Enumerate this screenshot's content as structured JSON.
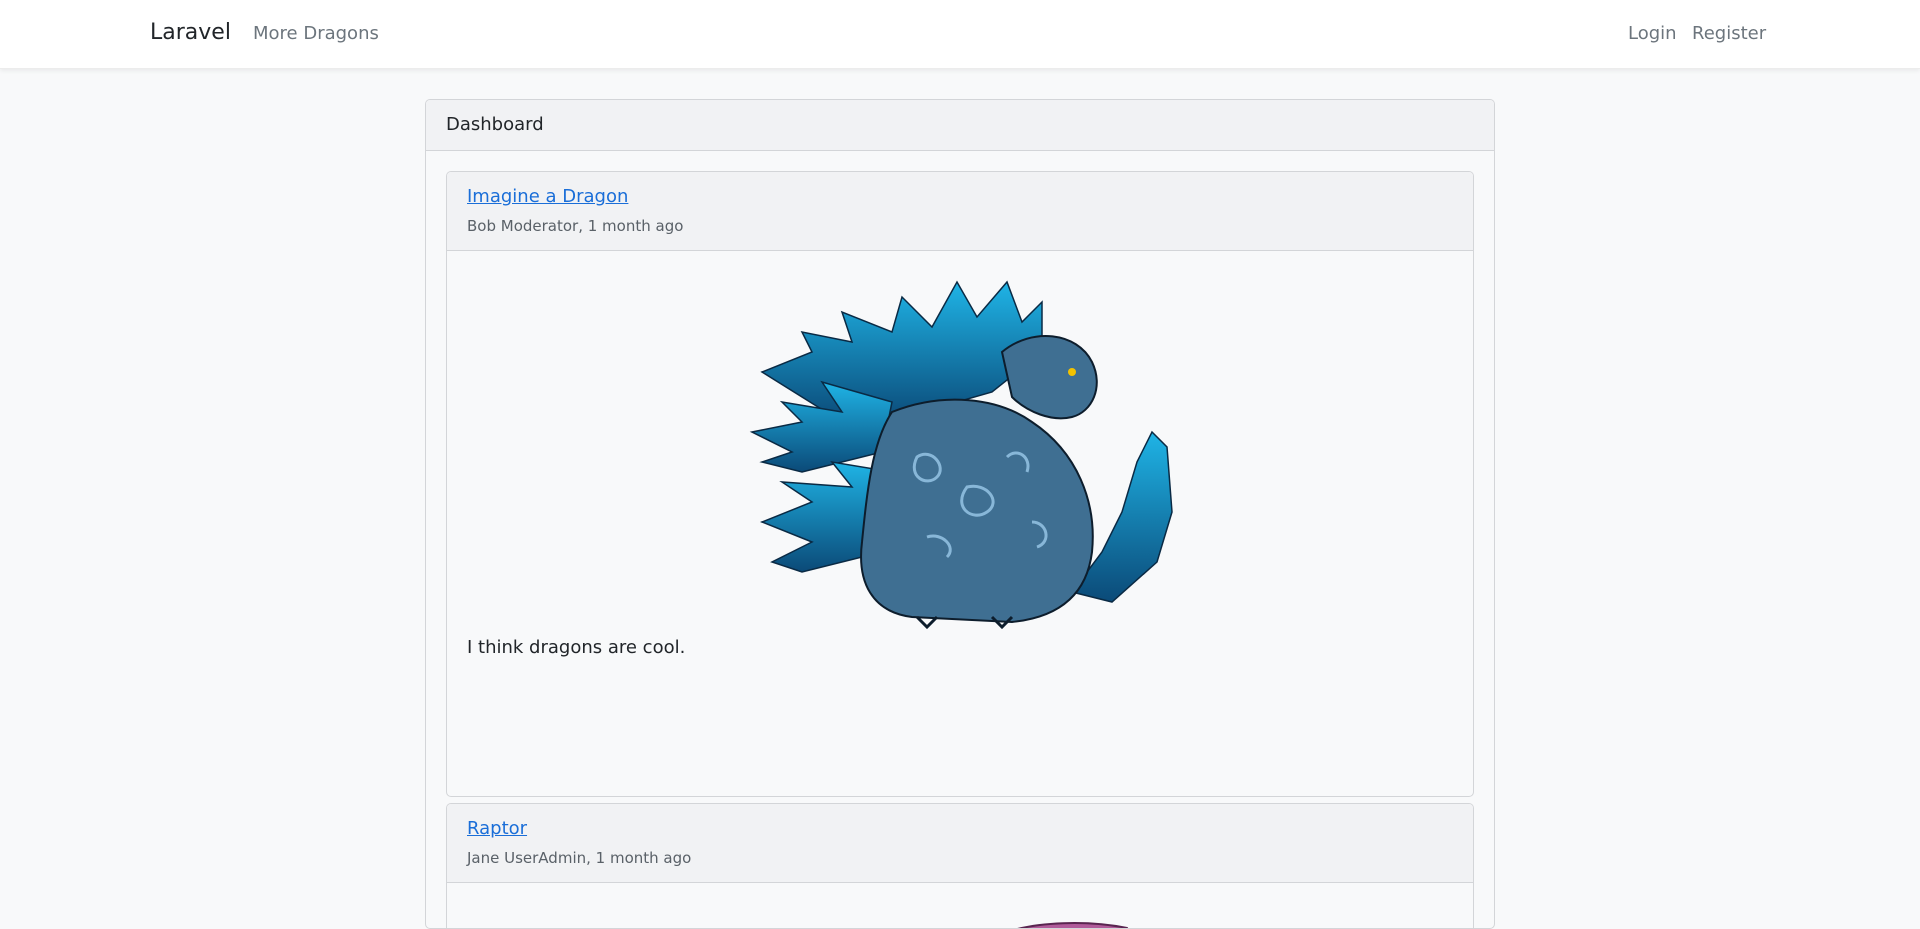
{
  "navbar": {
    "brand": "Laravel",
    "links": [
      "More Dragons"
    ],
    "auth": {
      "login": "Login",
      "register": "Register"
    }
  },
  "card": {
    "header": "Dashboard",
    "posts": [
      {
        "title": "Imagine a Dragon",
        "meta": "Bob Moderator, 1 month ago",
        "image": "blue-dragon-image",
        "body": "I think dragons are cool."
      },
      {
        "title": "Raptor",
        "meta": "Jane UserAdmin, 1 month ago",
        "image": "pink-dragon-image"
      }
    ]
  },
  "colors": {
    "link": "#1a6ed8",
    "muted": "#6c757d",
    "page_bg": "#f8f9fa",
    "header_bg": "#f1f2f4"
  }
}
